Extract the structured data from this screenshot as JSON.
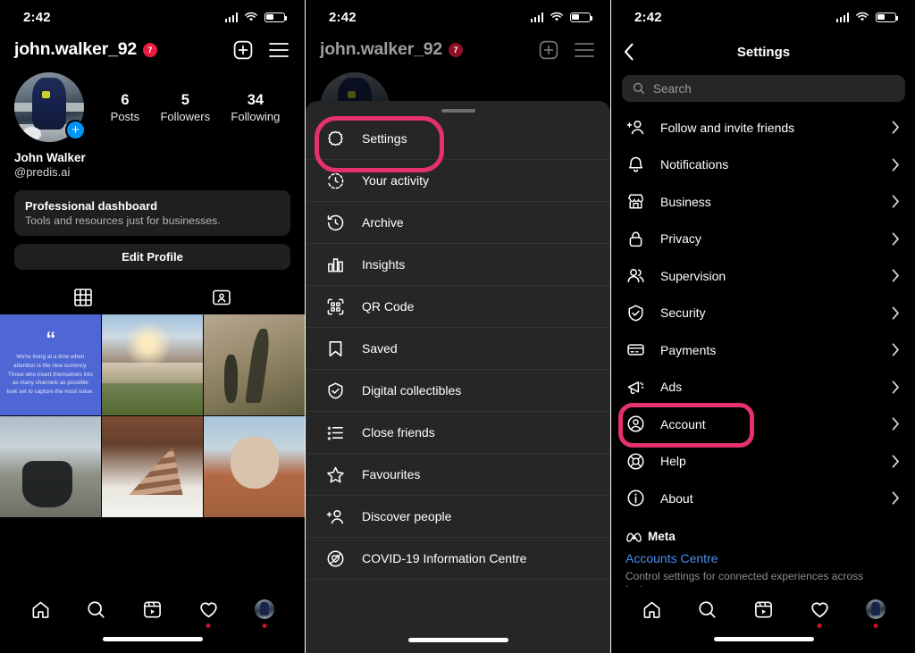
{
  "statusbar": {
    "time": "2:42",
    "signal_icon": "cellular-signal-icon",
    "wifi_icon": "wifi-icon",
    "battery_icon": "battery-icon"
  },
  "panel1": {
    "name": "instagram-profile-screen",
    "header": {
      "username": "john.walker_92",
      "notification_badge": "7",
      "add_icon": "plus-square-icon",
      "menu_icon": "hamburger-menu-icon"
    },
    "profile": {
      "avatar_alt": "profile-photo",
      "add_story_icon": "plus-icon",
      "full_name": "John Walker",
      "handle": "@predis.ai",
      "stats": [
        {
          "num": "6",
          "label": "Posts"
        },
        {
          "num": "5",
          "label": "Followers"
        },
        {
          "num": "34",
          "label": "Following"
        }
      ],
      "dashboard_title": "Professional dashboard",
      "dashboard_sub": "Tools and resources just for businesses.",
      "edit_profile": "Edit Profile"
    },
    "tabs": [
      {
        "name": "grid-tab",
        "icon": "grid-icon"
      },
      {
        "name": "tagged-tab",
        "icon": "tagged-person-icon"
      }
    ],
    "grid": [
      {
        "type": "quote",
        "quote_mark": "“",
        "text": "We're living at a time when attention is the new currency. Those who insert themselves into as many channels as possible look set to capture the most value."
      },
      {
        "type": "photo",
        "alt": "beach-sunset-photo"
      },
      {
        "type": "photo",
        "alt": "shadow-walk-dogs-photo"
      },
      {
        "type": "photo",
        "alt": "motorcycle-mountain-photo"
      },
      {
        "type": "photo",
        "alt": "chocolate-cake-slice-photo"
      },
      {
        "type": "photo",
        "alt": "bulldog-on-deck-photo"
      }
    ]
  },
  "panel2": {
    "name": "profile-side-menu-drawer",
    "header": {
      "username": "john.walker_92",
      "notification_badge": "7"
    },
    "highlight": {
      "target": "Settings",
      "color": "#E5316C"
    },
    "items": [
      {
        "label": "Settings",
        "icon": "gear-icon"
      },
      {
        "label": "Your activity",
        "icon": "activity-clock-icon"
      },
      {
        "label": "Archive",
        "icon": "archive-clock-icon"
      },
      {
        "label": "Insights",
        "icon": "insights-bar-chart-icon"
      },
      {
        "label": "QR Code",
        "icon": "qr-code-icon"
      },
      {
        "label": "Saved",
        "icon": "bookmark-icon"
      },
      {
        "label": "Digital collectibles",
        "icon": "shield-check-icon"
      },
      {
        "label": "Close friends",
        "icon": "close-friends-list-icon"
      },
      {
        "label": "Favourites",
        "icon": "star-icon"
      },
      {
        "label": "Discover people",
        "icon": "add-person-icon"
      },
      {
        "label": "COVID-19 Information Centre",
        "icon": "covid-info-icon"
      }
    ]
  },
  "panel3": {
    "name": "instagram-settings-screen",
    "back_icon": "back-chevron-icon",
    "title": "Settings",
    "search": {
      "placeholder": "Search",
      "icon": "search-icon"
    },
    "highlight": {
      "target": "Account",
      "color": "#E5316C"
    },
    "items": [
      {
        "label": "Follow and invite friends",
        "icon": "add-person-icon",
        "chevron": "chevron-right-icon"
      },
      {
        "label": "Notifications",
        "icon": "bell-icon",
        "chevron": "chevron-right-icon"
      },
      {
        "label": "Business",
        "icon": "storefront-icon",
        "chevron": "chevron-right-icon"
      },
      {
        "label": "Privacy",
        "icon": "lock-icon",
        "chevron": "chevron-right-icon"
      },
      {
        "label": "Supervision",
        "icon": "two-people-icon",
        "chevron": "chevron-right-icon"
      },
      {
        "label": "Security",
        "icon": "shield-check-icon",
        "chevron": "chevron-right-icon"
      },
      {
        "label": "Payments",
        "icon": "credit-card-icon",
        "chevron": "chevron-right-icon"
      },
      {
        "label": "Ads",
        "icon": "megaphone-icon",
        "chevron": "chevron-right-icon"
      },
      {
        "label": "Account",
        "icon": "account-circle-icon",
        "chevron": "chevron-right-icon"
      },
      {
        "label": "Help",
        "icon": "lifebuoy-icon",
        "chevron": "chevron-right-icon"
      },
      {
        "label": "About",
        "icon": "info-circle-icon",
        "chevron": "chevron-right-icon"
      }
    ],
    "meta": {
      "brand": "Meta",
      "brand_icon": "meta-infinity-icon",
      "link": "Accounts Centre",
      "description": "Control settings for connected experiences across Instagram"
    }
  },
  "bottomnav": {
    "items": [
      {
        "name": "home-tab",
        "icon": "home-icon",
        "dot": false
      },
      {
        "name": "search-tab",
        "icon": "search-icon",
        "dot": false
      },
      {
        "name": "reels-tab",
        "icon": "reels-icon",
        "dot": false
      },
      {
        "name": "activity-tab",
        "icon": "heart-icon",
        "dot": true
      },
      {
        "name": "profile-tab",
        "icon": "avatar-icon",
        "dot": true
      }
    ],
    "home_indicator": "home-indicator-bar"
  }
}
